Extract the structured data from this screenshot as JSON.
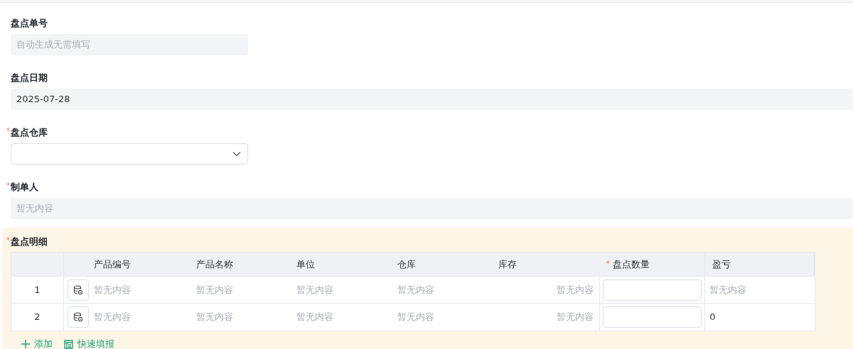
{
  "fields": [
    {
      "label": "盘点单号",
      "kind": "readonly",
      "placeholder": "自动生成无需填写"
    },
    {
      "label": "盘点日期",
      "kind": "readonly",
      "value": "2025-07-28"
    },
    {
      "label": "盘点仓库",
      "required_mark": "*",
      "kind": "select"
    },
    {
      "label": "制单人",
      "required_mark": "*",
      "kind": "readonly",
      "placeholder": "暂无内容"
    }
  ],
  "detail": {
    "label": "盘点明细",
    "required_mark": "*",
    "columns": [
      {},
      {
        "label": "产品编号"
      },
      {
        "label": "产品名称"
      },
      {
        "label": "单位"
      },
      {
        "label": "仓库"
      },
      {
        "label": "库存"
      },
      {
        "label": "盘点数量",
        "required_mark": "*"
      },
      {
        "label": "盈亏"
      }
    ],
    "rows": [
      {
        "index": "1",
        "code": {
          "text": "暂无内容",
          "empty": true
        },
        "name": {
          "text": "暂无内容",
          "empty": true
        },
        "unit": {
          "text": "暂无内容",
          "empty": true
        },
        "warehouse": {
          "text": "暂无内容",
          "empty": true
        },
        "stock": {
          "text": "暂无内容",
          "empty": true
        },
        "profit": {
          "text": "暂无内容",
          "empty": true
        }
      },
      {
        "index": "2",
        "code": {
          "text": "暂无内容",
          "empty": true
        },
        "name": {
          "text": "暂无内容",
          "empty": true
        },
        "unit": {
          "text": "暂无内容",
          "empty": true
        },
        "warehouse": {
          "text": "暂无内容",
          "empty": true
        },
        "stock": {
          "text": "暂无内容",
          "empty": true
        },
        "profit": {
          "text": "0",
          "empty": false
        }
      }
    ],
    "actions": [
      {
        "kind": "add",
        "label": "添加"
      },
      {
        "kind": "quick",
        "label": "快速填报"
      }
    ]
  }
}
